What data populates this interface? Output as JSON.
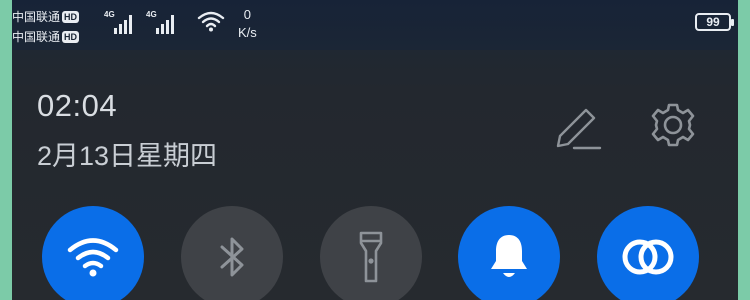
{
  "statusbar": {
    "carrier1": "中国联通",
    "carrier2": "中国联通",
    "hd_badge": "HD",
    "sim1_network": "4G",
    "sim2_network": "4G",
    "net_speed_value": "0",
    "net_speed_unit": "K/s",
    "battery_level": "99",
    "icons": [
      "signal-icon",
      "signal-icon",
      "wifi-status-icon",
      "battery-icon"
    ]
  },
  "panel": {
    "time": "02:04",
    "date": "2月13日星期四",
    "edit_icon": "pencil-icon",
    "settings_icon": "gear-icon"
  },
  "toggles": [
    {
      "id": "wifi",
      "icon": "wifi-icon",
      "state": "on"
    },
    {
      "id": "bluetooth",
      "icon": "bluetooth-icon",
      "state": "off"
    },
    {
      "id": "flashlight",
      "icon": "flashlight-icon",
      "state": "off"
    },
    {
      "id": "sound",
      "icon": "bell-icon",
      "state": "on"
    },
    {
      "id": "huawei-share",
      "icon": "share-rings-icon",
      "state": "on"
    }
  ],
  "colors": {
    "accent": "#0a6ee8",
    "tile_off": "#3f4247",
    "panel_bg": "#262a2f",
    "text": "#d9dde2",
    "side_border": "#7ccba8"
  }
}
